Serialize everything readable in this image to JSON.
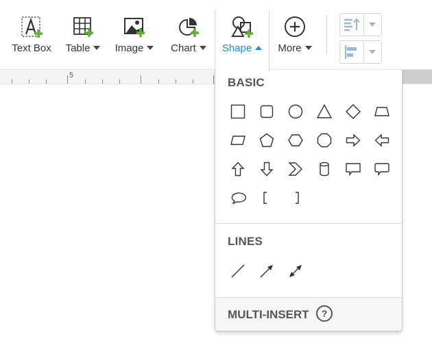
{
  "toolbar": {
    "buttons": [
      {
        "label": "Text Box",
        "icon": "text-box-icon"
      },
      {
        "label": "Table",
        "icon": "table-icon"
      },
      {
        "label": "Image",
        "icon": "image-icon"
      },
      {
        "label": "Chart",
        "icon": "chart-icon"
      },
      {
        "label": "Shape",
        "icon": "shape-icon"
      },
      {
        "label": "More",
        "icon": "plus-circle-icon"
      }
    ],
    "accent_color": "#1e8fd6",
    "add_badge_color": "#5ab52c"
  },
  "ruler": {
    "marker": "5"
  },
  "shape_menu": {
    "basic_title": "BASIC",
    "basic_shapes": [
      "rectangle",
      "rounded-rectangle",
      "circle",
      "triangle",
      "diamond",
      "trapezoid",
      "parallelogram",
      "pentagon",
      "hexagon",
      "octagon",
      "arrow-right",
      "arrow-left",
      "arrow-up",
      "arrow-down",
      "chevron",
      "cylinder",
      "callout-rectangle",
      "callout-rounded",
      "callout-oval",
      "bracket-left",
      "bracket-right"
    ],
    "lines_title": "LINES",
    "line_shapes": [
      "line",
      "arrow-line",
      "double-arrow-line"
    ],
    "multi_insert_label": "MULTI-INSERT",
    "help_label": "?"
  }
}
